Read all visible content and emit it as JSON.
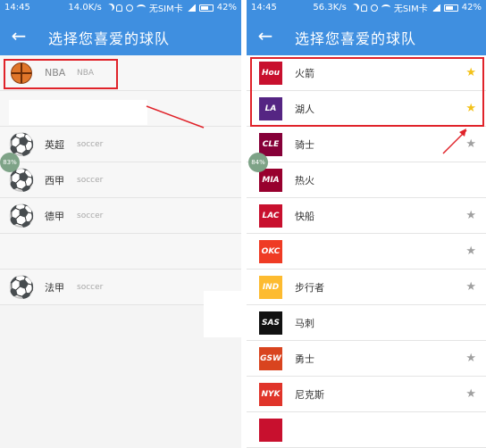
{
  "status_left": {
    "time": "14:45",
    "speed": "14.0K/s",
    "carrier": "无SIM卡",
    "battery": "42%"
  },
  "status_right": {
    "time": "14:45",
    "speed": "56.3K/s",
    "carrier": "无SIM卡",
    "battery": "42%"
  },
  "appbar": {
    "back_icon": "←",
    "title": "选择您喜爱的球队"
  },
  "leagues": [
    {
      "name": "NBA",
      "sub": "NBA",
      "icon": "basketball-icon"
    },
    {
      "name": "",
      "sub": "",
      "icon": ""
    },
    {
      "name": "英超",
      "sub": "soccer",
      "icon": "soccer-ball-icon"
    },
    {
      "name": "西甲",
      "sub": "soccer",
      "icon": "soccer-ball-icon"
    },
    {
      "name": "德甲",
      "sub": "soccer",
      "icon": "soccer-ball-icon"
    },
    {
      "name": "",
      "sub": "",
      "icon": ""
    },
    {
      "name": "法甲",
      "sub": "soccer",
      "icon": "soccer-ball-icon"
    }
  ],
  "badges": {
    "left": "83%",
    "right": "84%"
  },
  "teams": [
    {
      "name": "火箭",
      "logo_text": "Hou",
      "logo_color": "#c8102e",
      "starred": true,
      "show_star": true
    },
    {
      "name": "湖人",
      "logo_text": "LA",
      "logo_color": "#552583",
      "starred": true,
      "show_star": true
    },
    {
      "name": "骑士",
      "logo_text": "CLE",
      "logo_color": "#860038",
      "starred": false,
      "show_star": true
    },
    {
      "name": "热火",
      "logo_text": "MIA",
      "logo_color": "#98002e",
      "starred": false,
      "show_star": false
    },
    {
      "name": "快船",
      "logo_text": "LAC",
      "logo_color": "#c8102e",
      "starred": false,
      "show_star": true
    },
    {
      "name": "",
      "logo_text": "OKC",
      "logo_color": "#ef3b24",
      "starred": false,
      "show_star": true
    },
    {
      "name": "步行者",
      "logo_text": "IND",
      "logo_color": "#fdbb30",
      "starred": false,
      "show_star": true
    },
    {
      "name": "马刺",
      "logo_text": "SAS",
      "logo_color": "#111111",
      "starred": false,
      "show_star": false
    },
    {
      "name": "勇士",
      "logo_text": "GSW",
      "logo_color": "#d9441f",
      "starred": false,
      "show_star": true
    },
    {
      "name": "尼克斯",
      "logo_text": "NYK",
      "logo_color": "#e0342a",
      "starred": false,
      "show_star": true
    },
    {
      "name": "",
      "logo_text": "",
      "logo_color": "#c8102e",
      "starred": false,
      "show_star": false
    }
  ],
  "icons": {
    "star": "★"
  },
  "colors": {
    "primary": "#3f8fe0",
    "highlight": "#e0232a",
    "star_on": "#f3c21b",
    "star_off": "#a0a0a0"
  }
}
